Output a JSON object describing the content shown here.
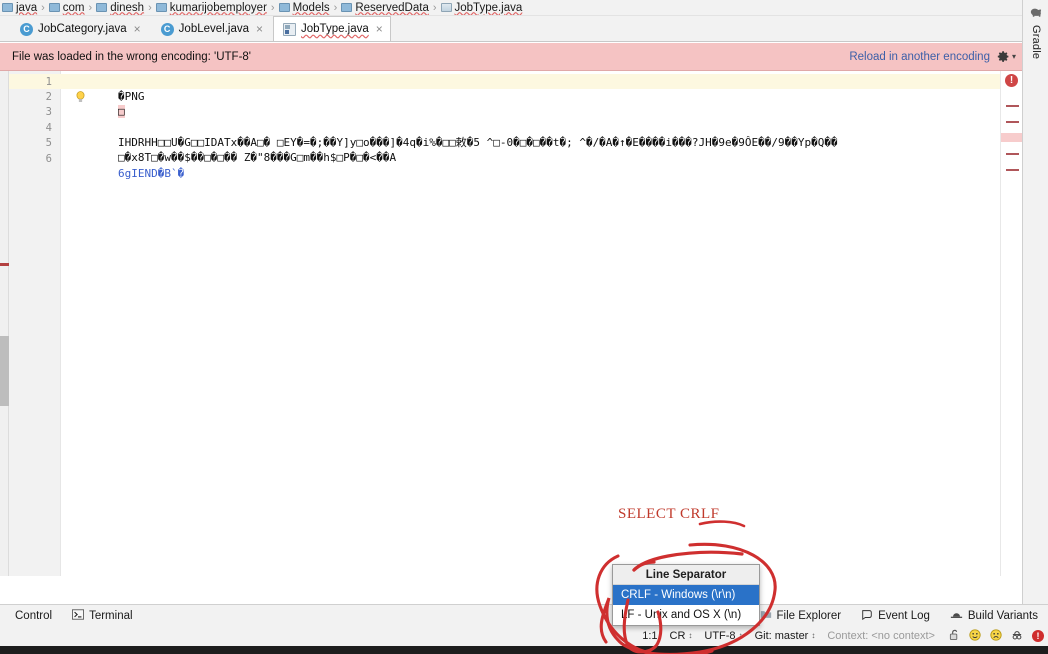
{
  "breadcrumb": {
    "items": [
      {
        "label": "java",
        "icon": "folder-icon"
      },
      {
        "label": "com",
        "icon": "folder-icon"
      },
      {
        "label": "dinesh",
        "icon": "folder-icon"
      },
      {
        "label": "kumarijobemployer",
        "icon": "folder-icon"
      },
      {
        "label": "Models",
        "icon": "folder-icon"
      },
      {
        "label": "ReservedData",
        "icon": "folder-icon"
      },
      {
        "label": "JobType.java",
        "icon": "file-icon"
      }
    ],
    "separator": "›"
  },
  "tabs": [
    {
      "label": "JobCategory.java",
      "icon": "java-class-icon",
      "active": false,
      "close": "×"
    },
    {
      "label": "JobLevel.java",
      "icon": "java-class-icon",
      "active": false,
      "close": "×"
    },
    {
      "label": "JobType.java",
      "icon": "binary-file-icon",
      "active": true,
      "close": "×"
    }
  ],
  "banner": {
    "message": "File was loaded in the wrong encoding: 'UTF-8'",
    "link": "Reload in another encoding",
    "gear_icon": "gear-icon",
    "caret": "▾",
    "background": "#f5c3c3"
  },
  "editor": {
    "line_numbers": [
      "1",
      "2",
      "3",
      "4",
      "5",
      "6"
    ],
    "lines": [
      {
        "n": 1,
        "text": "�PNG"
      },
      {
        "n": 2,
        "text": "□"
      },
      {
        "n": 3,
        "text": ""
      },
      {
        "n": 4,
        "text": "IHDRHH□□U�G□□IDATx��A□� □EY�=�;��Y]y□o���]�4q�i%�□□敕�5 ^□-0�□�□��t�; ^�/�A�↑�E����i���?JH�9e�9ÔE��/9��Yp�Q��"
      },
      {
        "n": 5,
        "text": "□�x8T□�w��$��□�□�� Z�\"8���G□m��h$□P�□�<��A"
      },
      {
        "n": 6,
        "text": "6gIEND�B`�"
      }
    ],
    "bulb_icon": "intention-bulb-icon",
    "stripe_error_icon": "error-marker-icon"
  },
  "right_rail": {
    "gradle_label": "Gradle",
    "gradle_icon": "gradle-elephant-icon"
  },
  "bottom_bar": {
    "items": [
      {
        "label": "Control",
        "icon": "version-control-icon"
      },
      {
        "label": "Terminal",
        "icon": "terminal-icon"
      },
      {
        "label": "File Explorer",
        "icon": "file-explorer-icon"
      },
      {
        "label": "Event Log",
        "icon": "event-log-icon"
      },
      {
        "label": "Build Variants",
        "icon": "build-variants-icon"
      }
    ]
  },
  "status_bar": {
    "caret_position": "1:1",
    "line_separator": "CR",
    "encoding": "UTF-8",
    "branch": "Git: master",
    "context": "Context: <no context>",
    "stepper": "↕",
    "icons": [
      {
        "name": "lock-icon",
        "glyph": "🔓"
      },
      {
        "name": "smiley-happy-icon",
        "glyph": "🙂"
      },
      {
        "name": "smiley-sad-icon",
        "glyph": "🙁"
      },
      {
        "name": "inspector-icon",
        "glyph": "🕵"
      },
      {
        "name": "error-badge-icon",
        "glyph": "!"
      }
    ]
  },
  "popup": {
    "title": "Line Separator",
    "options": [
      {
        "label": "CRLF - Windows (\\r\\n)",
        "selected": true
      },
      {
        "label": "LF - Unix and OS X (\\n)",
        "selected": false
      }
    ],
    "highlight_color": "#2a72c8"
  },
  "annotation": {
    "text": "SELECT CRLF",
    "color": "#c0392b",
    "shapes": "hand-drawn-circle-and-arrow"
  }
}
